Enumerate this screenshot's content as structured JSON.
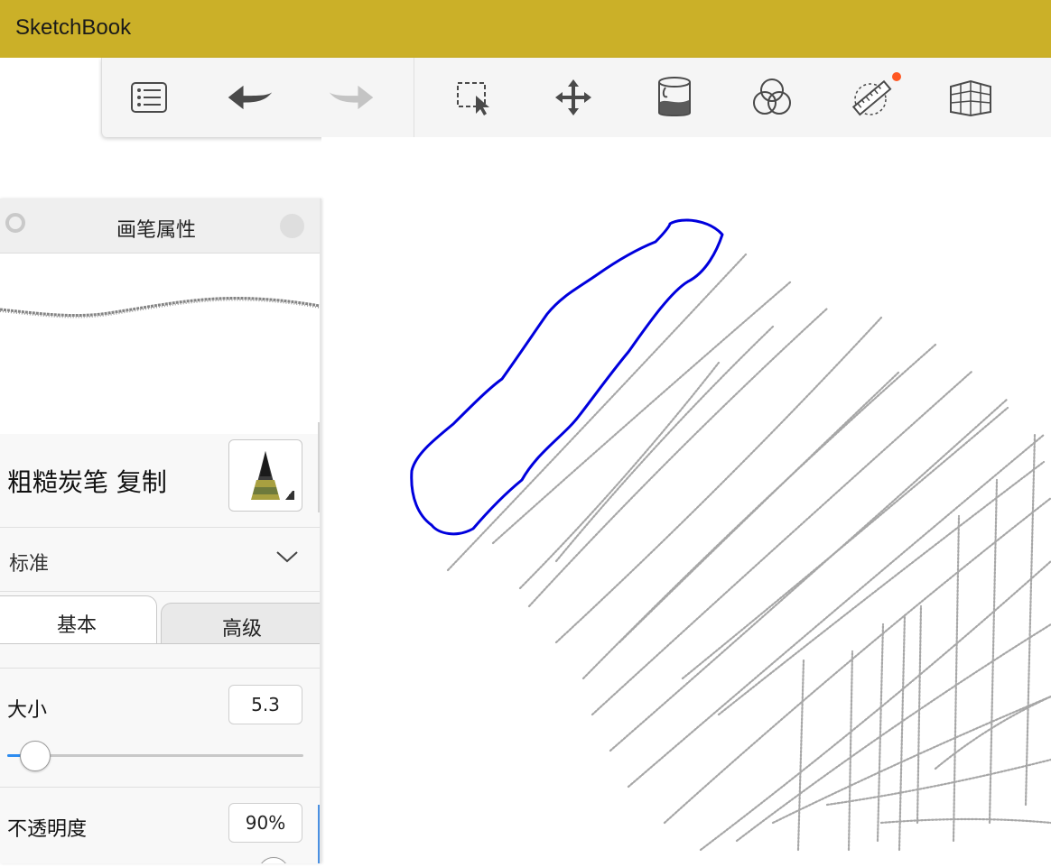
{
  "app": {
    "title": "SketchBook"
  },
  "toolbar": {
    "tools": [
      {
        "name": "brush-list-icon"
      },
      {
        "name": "undo-icon"
      },
      {
        "name": "redo-icon"
      },
      {
        "name": "selection-icon"
      },
      {
        "name": "transform-move-icon"
      },
      {
        "name": "paint-bucket-icon"
      },
      {
        "name": "color-circles-icon"
      },
      {
        "name": "ruler-icon"
      },
      {
        "name": "perspective-grid-icon"
      }
    ],
    "colors": {
      "background": "#f5f5f5",
      "icon": "#4a4a4a",
      "disabled_icon": "#c4c4c4",
      "badge": "#ff5722"
    }
  },
  "brush_panel": {
    "title": "画笔属性",
    "brush_name": "粗糙炭笔 复制",
    "preset": "标准",
    "tabs": [
      {
        "label": "基本",
        "active": true
      },
      {
        "label": "高级",
        "active": false
      }
    ],
    "properties": {
      "size": {
        "label": "大小",
        "value": "5.3",
        "slider_fraction": 0.095
      },
      "opacity": {
        "label": "不透明度",
        "value": "90%",
        "slider_fraction": 0.9
      }
    }
  },
  "canvas": {
    "stroke_color": "#0000dd",
    "hatch_color": "#8a8a8a"
  },
  "colors": {
    "titlebar": "#cbb028",
    "slider_accent": "#2d8cf0"
  }
}
